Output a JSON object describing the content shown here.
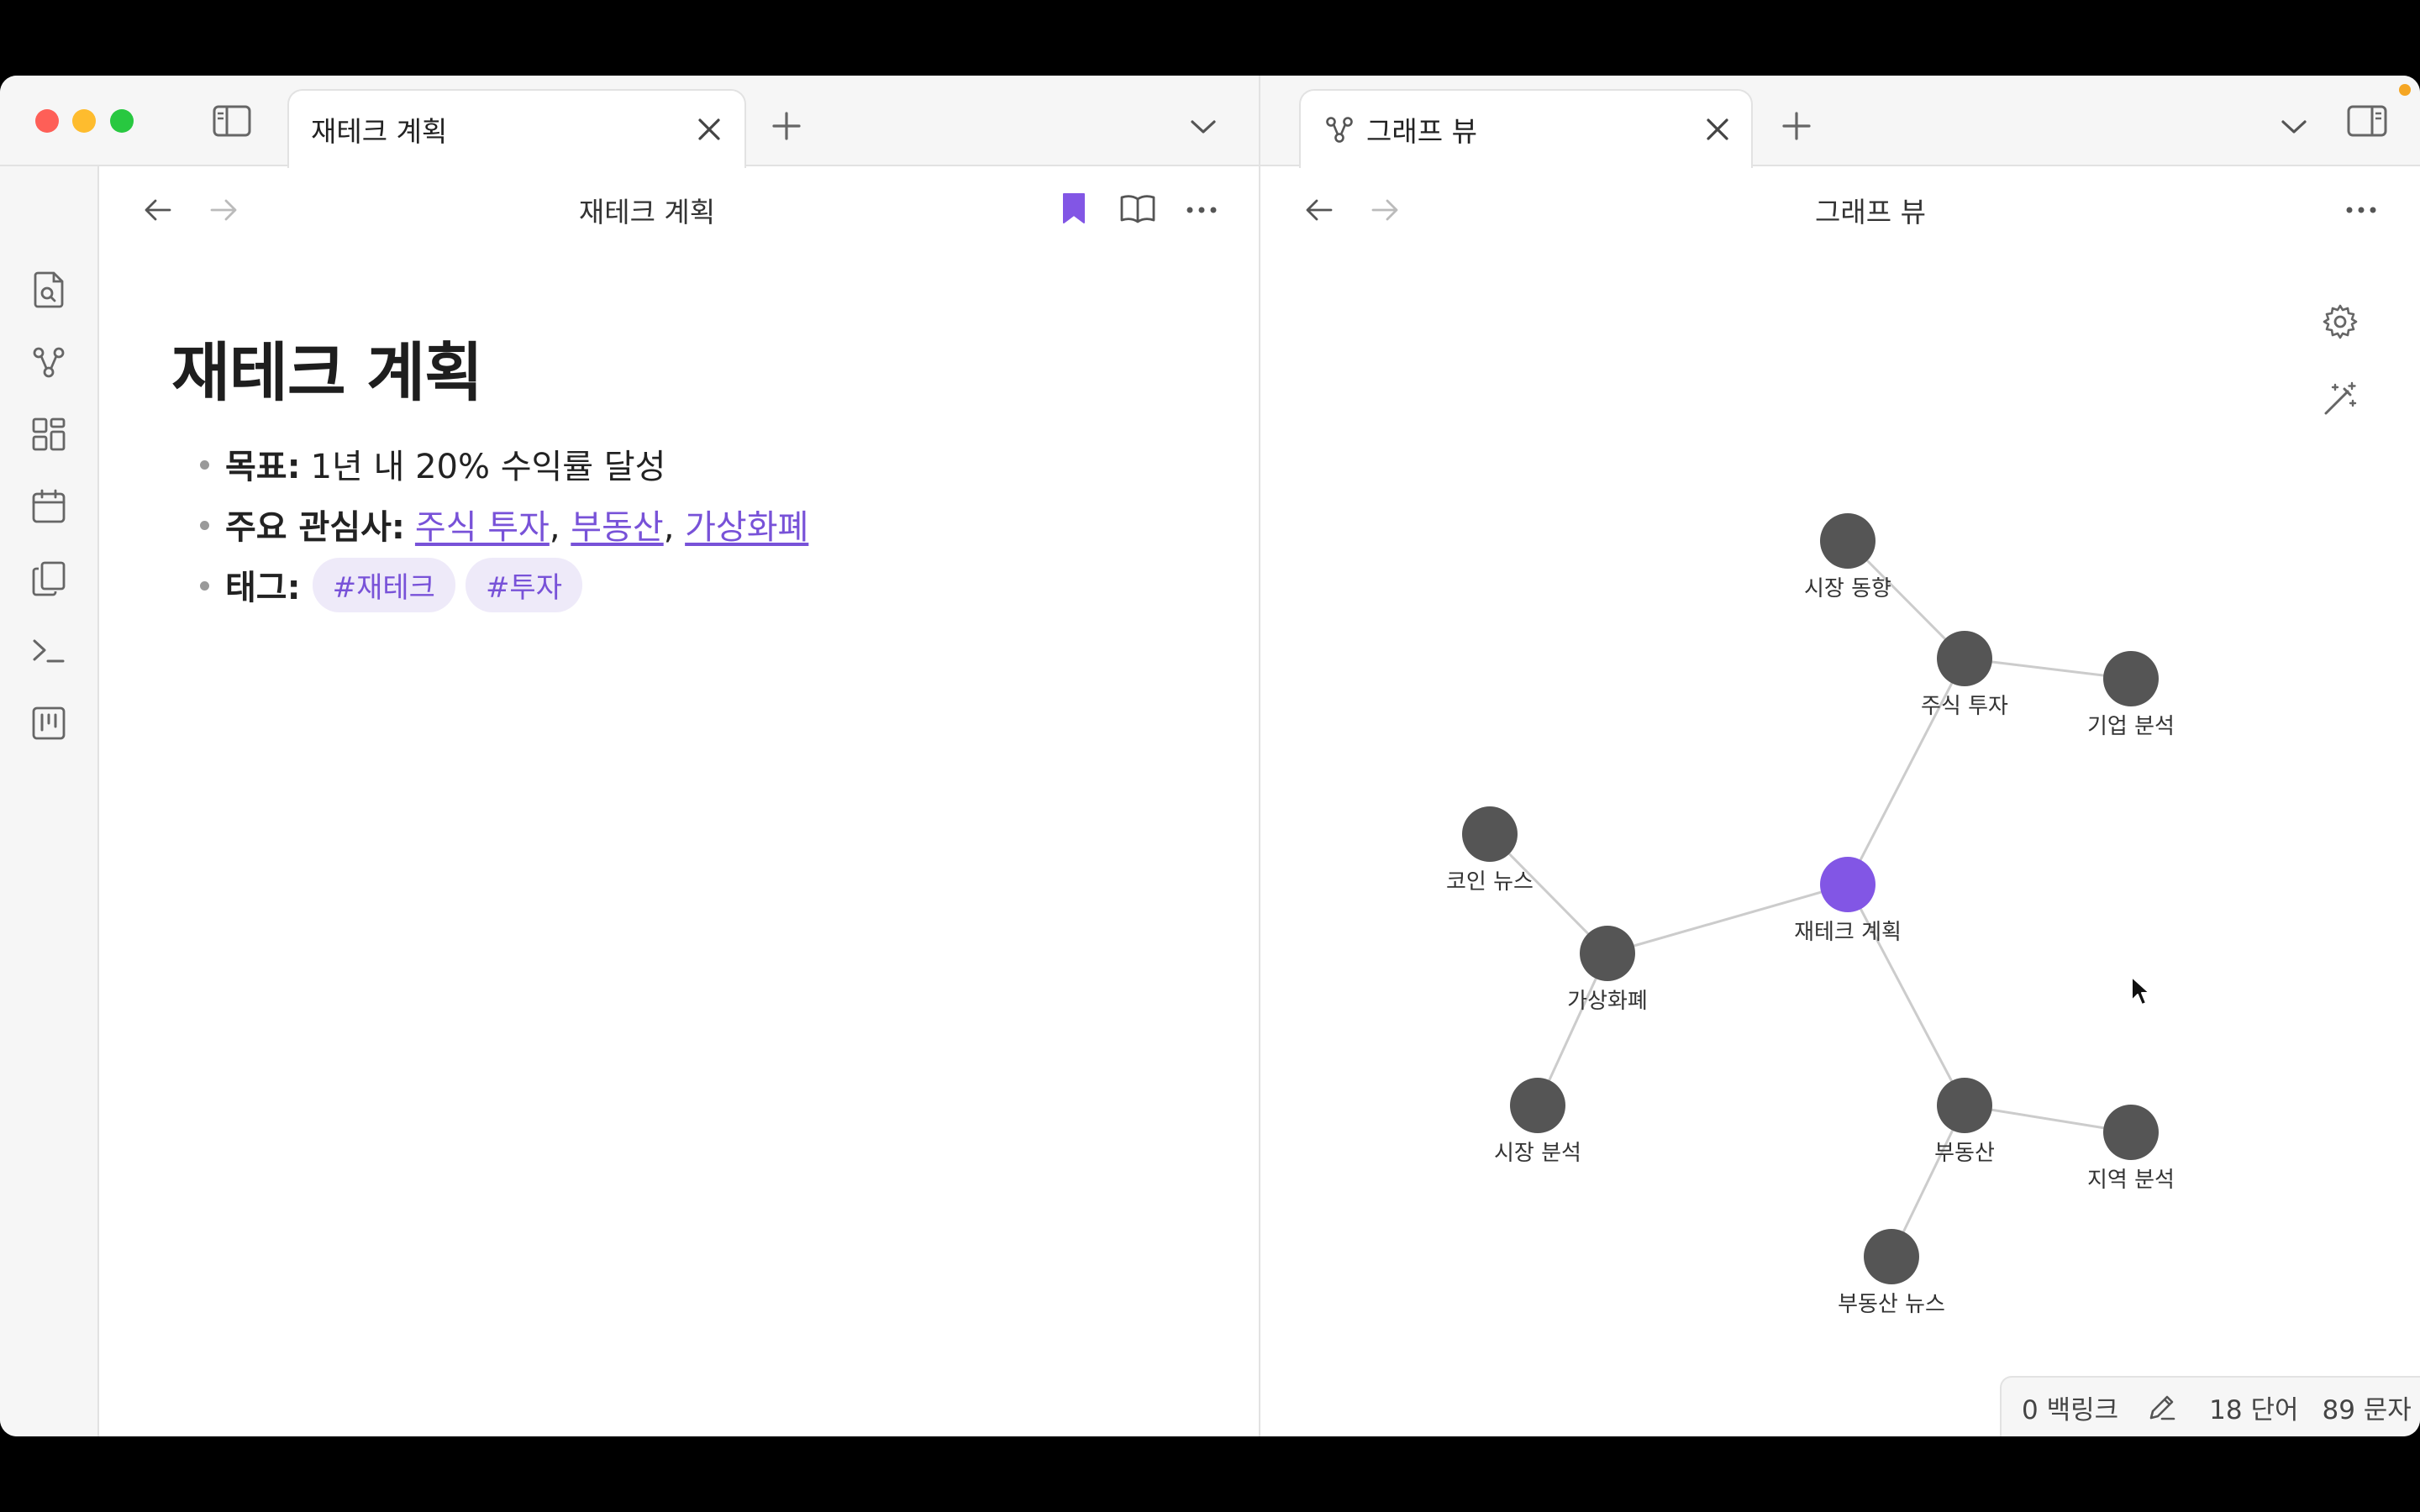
{
  "left_pane": {
    "tab_title": "재테크 계획",
    "header_title": "재테크 계획",
    "note": {
      "title": "재테크 계획",
      "bullets": [
        {
          "key": "목표:",
          "value": "1년 내 20% 수익률 달성"
        },
        {
          "key": "주요 관심사:",
          "links": [
            "주식 투자",
            "부동산",
            "가상화폐"
          ],
          "separator": ","
        },
        {
          "key": "태그:",
          "tags": [
            "#재테크",
            "#투자"
          ]
        }
      ]
    }
  },
  "right_pane": {
    "tab_title": "그래프 뷰",
    "header_title": "그래프 뷰",
    "graph": {
      "active_color": "#8256e5",
      "node_color": "#555555",
      "edge_color": "#cccccc",
      "nodes": [
        {
          "id": "n1",
          "label": "시장 동향",
          "active": false
        },
        {
          "id": "n2",
          "label": "주식 투자",
          "active": false
        },
        {
          "id": "n3",
          "label": "기업 분석",
          "active": false
        },
        {
          "id": "n4",
          "label": "코인 뉴스",
          "active": false
        },
        {
          "id": "n5",
          "label": "재테크 계획",
          "active": true
        },
        {
          "id": "n6",
          "label": "가상화폐",
          "active": false
        },
        {
          "id": "n7",
          "label": "시장 분석",
          "active": false
        },
        {
          "id": "n8",
          "label": "부동산",
          "active": false
        },
        {
          "id": "n9",
          "label": "지역 분석",
          "active": false
        },
        {
          "id": "n10",
          "label": "부동산 뉴스",
          "active": false
        }
      ],
      "edges": [
        [
          "n1",
          "n2"
        ],
        [
          "n2",
          "n3"
        ],
        [
          "n2",
          "n5"
        ],
        [
          "n5",
          "n6"
        ],
        [
          "n6",
          "n4"
        ],
        [
          "n6",
          "n7"
        ],
        [
          "n5",
          "n8"
        ],
        [
          "n8",
          "n9"
        ],
        [
          "n8",
          "n10"
        ]
      ]
    }
  },
  "status_bar": {
    "backlinks": "0 백링크",
    "words": "18 단어",
    "chars": "89 문자"
  },
  "colors": {
    "accent": "#7852d8",
    "bookmark": "#8256e5"
  },
  "icons": {
    "ribbon": [
      "search-file-icon",
      "graph-icon",
      "grid-icon",
      "calendar-icon",
      "copy-icon",
      "terminal-icon",
      "kanban-icon"
    ]
  }
}
